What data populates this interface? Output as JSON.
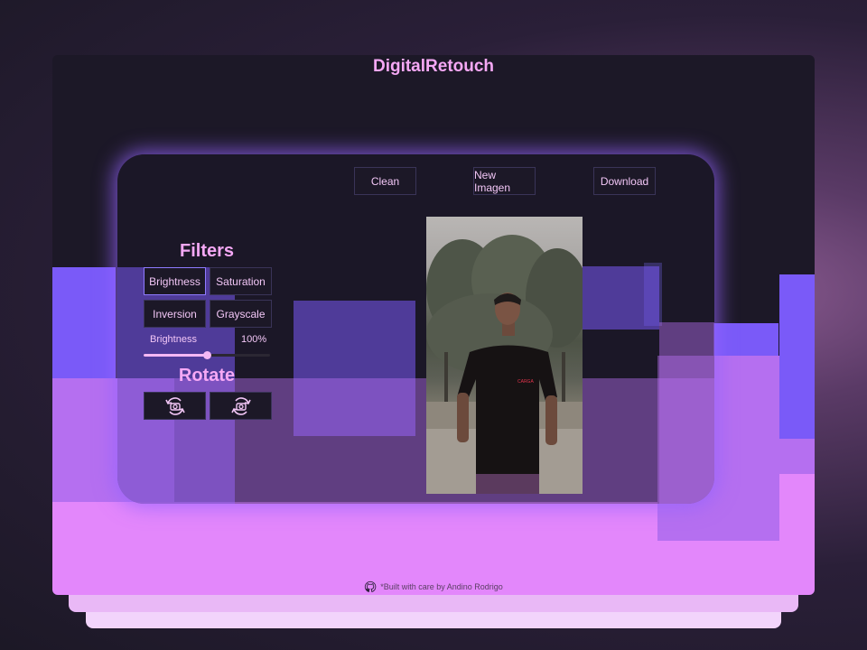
{
  "app": {
    "title": "DigitalRetouch"
  },
  "toolbar": {
    "clean_label": "Clean",
    "new_image_label": "New Imagen",
    "download_label": "Download"
  },
  "filters": {
    "title": "Filters",
    "buttons": [
      "Brightness",
      "Saturation",
      "Inversion",
      "Grayscale"
    ],
    "active": "Brightness",
    "slider": {
      "name": "Brightness",
      "value_text": "100%",
      "value": 100,
      "max": 200
    }
  },
  "rotate": {
    "title": "Rotate",
    "buttons": [
      "rotate-left-icon",
      "rotate-right-icon"
    ]
  },
  "photo": {
    "shirt_text": "CARGA"
  },
  "footer": {
    "text": "*Built with care by Andino Rodrigo",
    "icon": "github-icon"
  },
  "colors": {
    "accent": "#f5a8f5",
    "panel_glow": "#9664ff",
    "purple_block": "#7a5af8",
    "pink_block": "#e387fb",
    "window_bg": "#1c1827"
  }
}
